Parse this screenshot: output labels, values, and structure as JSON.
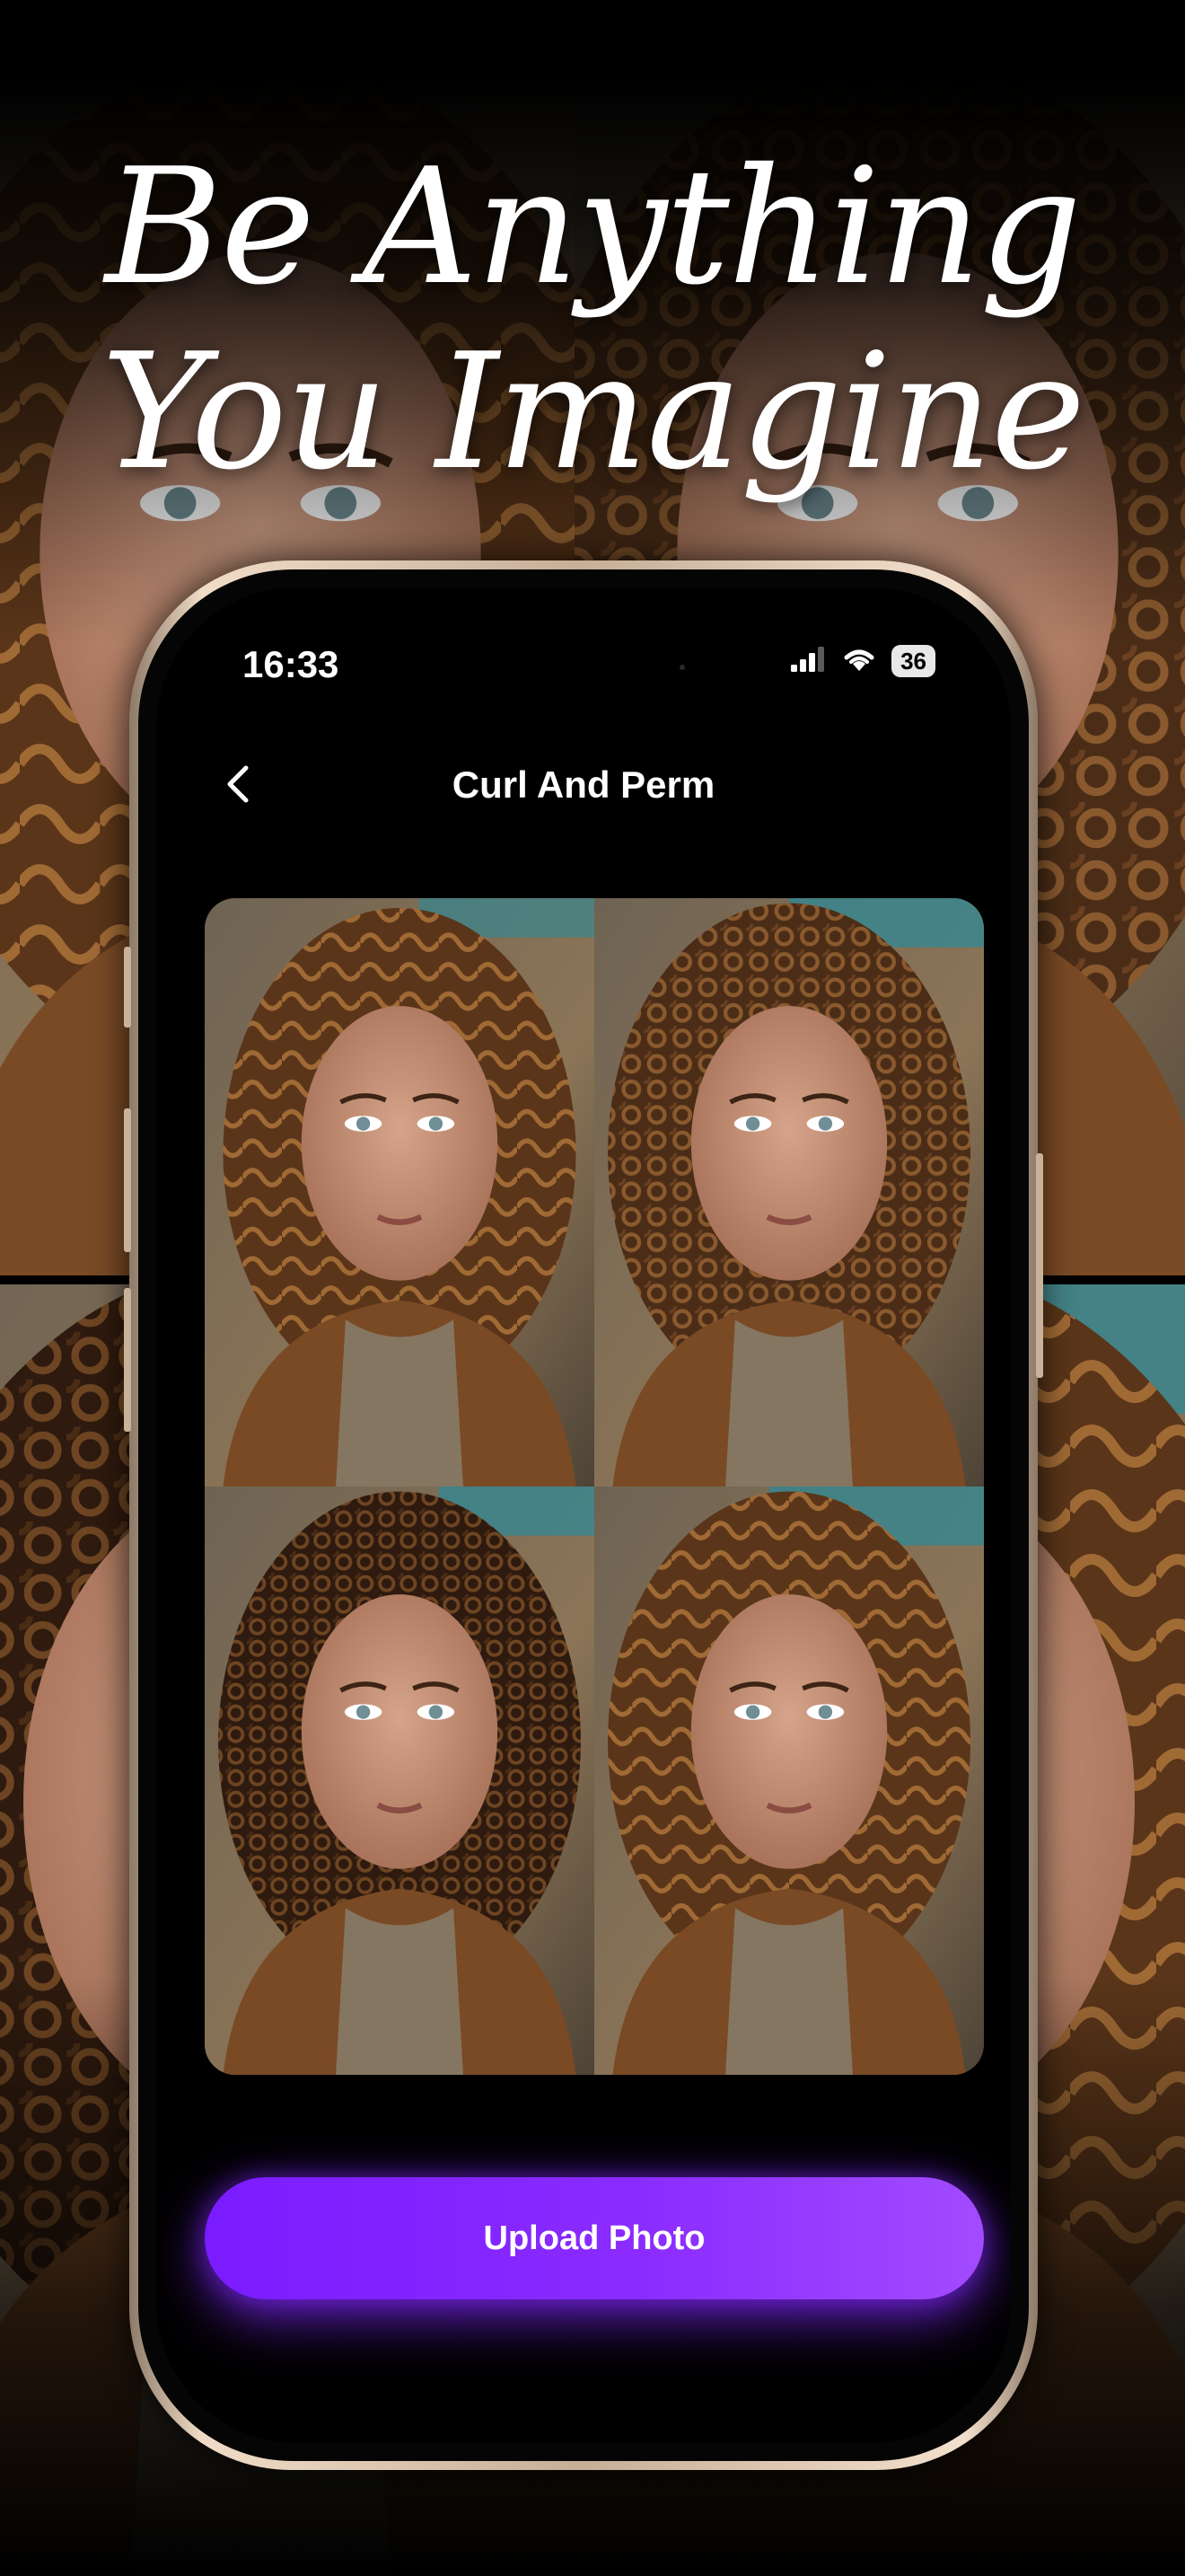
{
  "promo": {
    "headline_line1": "Be Anything",
    "headline_line2": "You Imagine"
  },
  "status_bar": {
    "time": "16:33",
    "battery": "36"
  },
  "nav": {
    "title": "Curl And Perm"
  },
  "upload": {
    "label": "Upload Photo"
  },
  "colors": {
    "accent": "#8a2bff",
    "background": "#000000",
    "frame": "#d9c3ad"
  },
  "icons": [
    "chevron-left-icon",
    "signal-icon",
    "wifi-icon",
    "battery-icon"
  ]
}
